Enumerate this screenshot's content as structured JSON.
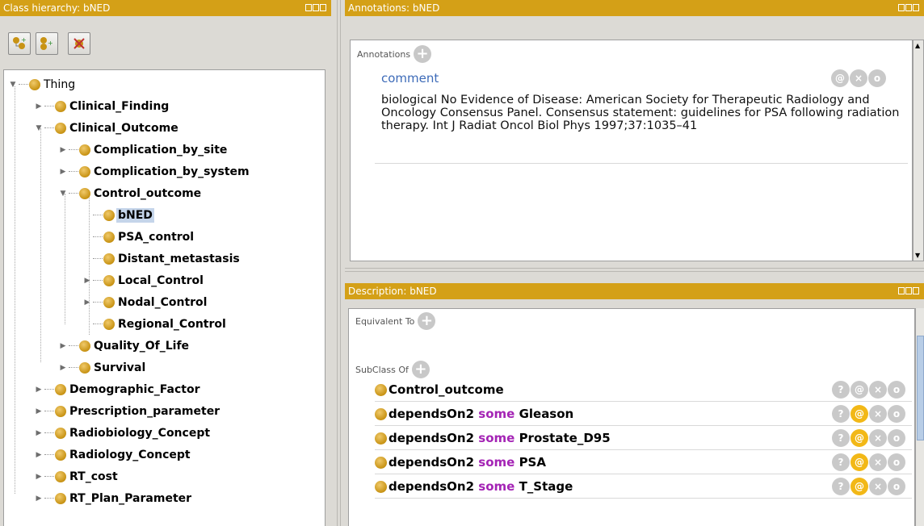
{
  "left_panel": {
    "title": "Class hierarchy: bNED",
    "toolbar": [
      "add-subclass-icon",
      "add-sibling-icon",
      "delete-class-icon"
    ],
    "tree": [
      {
        "label": "Thing",
        "expanded": true,
        "bold": false
      },
      {
        "label": "Clinical_Finding",
        "expanded": false
      },
      {
        "label": "Clinical_Outcome",
        "expanded": true
      },
      {
        "label": "Complication_by_site",
        "expanded": false
      },
      {
        "label": "Complication_by_system",
        "expanded": false
      },
      {
        "label": "Control_outcome",
        "expanded": true
      },
      {
        "label": "bNED",
        "selected": true
      },
      {
        "label": "PSA_control"
      },
      {
        "label": "Distant_metastasis"
      },
      {
        "label": "Local_Control",
        "expanded": false
      },
      {
        "label": "Nodal_Control",
        "expanded": false
      },
      {
        "label": "Regional_Control"
      },
      {
        "label": "Quality_Of_Life",
        "expanded": false
      },
      {
        "label": "Survival",
        "expanded": false
      },
      {
        "label": "Demographic_Factor",
        "expanded": false
      },
      {
        "label": "Prescription_parameter",
        "expanded": false
      },
      {
        "label": "Radiobiology_Concept",
        "expanded": false
      },
      {
        "label": "Radiology_Concept",
        "expanded": false
      },
      {
        "label": "RT_cost",
        "expanded": false
      },
      {
        "label": "RT_Plan_Parameter",
        "expanded": false
      }
    ]
  },
  "annotations_panel": {
    "title": "Annotations: bNED",
    "section_label": "Annotations",
    "annotation_property": "comment",
    "annotation_text": "biological No Evidence of Disease:  American Society for Therapeutic Radiology and Oncology Consensus Panel. Consensus statement: guidelines for PSA following radiation therapy. Int J Radiat Oncol Biol Phys 1997;37:1035–41",
    "actions": [
      "@",
      "×",
      "o"
    ]
  },
  "description_panel": {
    "title": "Description: bNED",
    "equivalent_label": "Equivalent To",
    "subclass_label": "SubClass Of",
    "subclass_rows": [
      {
        "property": "",
        "keyword": "",
        "filler": "Control_outcome",
        "annotated": false
      },
      {
        "property": "dependsOn2",
        "keyword": "some",
        "filler": "Gleason",
        "annotated": true
      },
      {
        "property": "dependsOn2",
        "keyword": "some",
        "filler": "Prostate_D95",
        "annotated": true
      },
      {
        "property": "dependsOn2",
        "keyword": "some",
        "filler": "PSA",
        "annotated": true
      },
      {
        "property": "dependsOn2",
        "keyword": "some",
        "filler": "T_Stage",
        "annotated": true
      }
    ],
    "row_actions": [
      "?",
      "@",
      "×",
      "o"
    ]
  },
  "colors": {
    "header": "#d4a017",
    "class_dot": "#c89314",
    "keyword": "#a424b5",
    "selection": "#c5d5ea",
    "annotation_link": "#3d6bb8",
    "active_action": "#f2b817"
  }
}
